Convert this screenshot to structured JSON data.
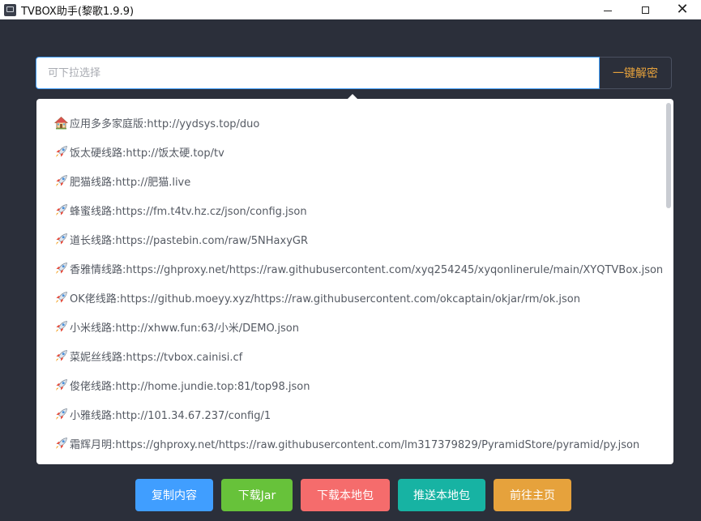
{
  "window": {
    "title": "TVBOX助手(黎歌1.9.9)",
    "controls": {
      "minimize": "",
      "maximize": "",
      "close": "✕"
    }
  },
  "search": {
    "placeholder": "可下拉选择",
    "value": "",
    "decrypt_label": "一键解密"
  },
  "dropdown": {
    "items": [
      {
        "icon": "house-icon",
        "label": "应用多多家庭版:http://yydsys.top/duo"
      },
      {
        "icon": "rocket-icon",
        "label": "饭太硬线路:http://饭太硬.top/tv"
      },
      {
        "icon": "rocket-icon",
        "label": "肥猫线路:http://肥猫.live"
      },
      {
        "icon": "rocket-icon",
        "label": "蜂蜜线路:https://fm.t4tv.hz.cz/json/config.json"
      },
      {
        "icon": "rocket-icon",
        "label": "道长线路:https://pastebin.com/raw/5NHaxyGR"
      },
      {
        "icon": "rocket-icon",
        "label": "香雅情线路:https://ghproxy.net/https://raw.githubusercontent.com/xyq254245/xyqonlinerule/main/XYQTVBox.json"
      },
      {
        "icon": "rocket-icon",
        "label": "OK佬线路:https://github.moeyy.xyz/https://raw.githubusercontent.com/okcaptain/okjar/rm/ok.json"
      },
      {
        "icon": "rocket-icon",
        "label": "小米线路:http://xhww.fun:63/小米/DEMO.json"
      },
      {
        "icon": "rocket-icon",
        "label": "菜妮丝线路:https://tvbox.cainisi.cf"
      },
      {
        "icon": "rocket-icon",
        "label": "俊佬线路:http://home.jundie.top:81/top98.json"
      },
      {
        "icon": "rocket-icon",
        "label": "小雅线路:http://101.34.67.237/config/1"
      },
      {
        "icon": "rocket-icon",
        "label": "霜辉月明:https://ghproxy.net/https://raw.githubusercontent.com/lm317379829/PyramidStore/pyramid/py.json"
      }
    ]
  },
  "actions": [
    {
      "name": "copy-content-button",
      "label": "复制内容",
      "color": "#409eff"
    },
    {
      "name": "download-jar-button",
      "label": "下载Jar",
      "color": "#67c23a"
    },
    {
      "name": "download-local-package-button",
      "label": "下载本地包",
      "color": "#f56c6c"
    },
    {
      "name": "push-local-package-button",
      "label": "推送本地包",
      "color": "#17b3a3"
    },
    {
      "name": "go-homepage-button",
      "label": "前往主页",
      "color": "#e6a23c"
    }
  ]
}
